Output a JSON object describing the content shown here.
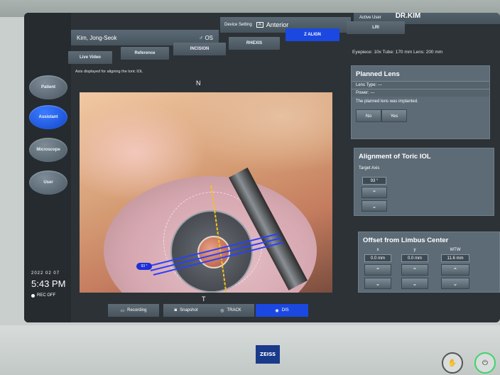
{
  "sidebar": {
    "items": [
      {
        "label": "Patient",
        "active": false
      },
      {
        "label": "Assistant",
        "active": true
      },
      {
        "label": "Microscope",
        "active": false
      },
      {
        "label": "User",
        "active": false
      }
    ],
    "date": "2022  02  07",
    "time": "5:43 PM",
    "rec": "REC OFF"
  },
  "header": {
    "patient_name": "Kim, Jong-Seok",
    "eye": "♂  OS",
    "device_setting_label": "Device Setting",
    "device_setting_badge": "A",
    "device_setting_value": "Anterior",
    "active_user_label": "Active User",
    "active_user": "DR.KIM"
  },
  "tabs_top": [
    {
      "label": "Z ALIGN",
      "active": true
    },
    {
      "label": "LRI",
      "active": false
    }
  ],
  "tabs_second": [
    {
      "label": "Live Video"
    },
    {
      "label": "Reference"
    },
    {
      "label": "INCISION"
    },
    {
      "label": "RHEXIS"
    }
  ],
  "eyepiece_info": "Eyepiece:  10x    Tube:  170 mm    Lens:  200 mm",
  "video": {
    "hint": "Axis displayed for aligning the toric IOL",
    "north": "N",
    "south": "T",
    "axis_tag": "93 °"
  },
  "bottom_tabs": [
    {
      "label": "Recording",
      "icon": "record-icon"
    },
    {
      "label": "Snapshot",
      "icon": "camera-icon"
    },
    {
      "label": "TRACK",
      "icon": "track-icon"
    },
    {
      "label": "DIS",
      "icon": "dis-icon",
      "active": true
    }
  ],
  "planned_lens": {
    "title": "Planned Lens",
    "lens_type": "Lens Type:  ---",
    "power": "Power:  ---",
    "implanted_text": "The planned lens was implanted.",
    "no_label": "No",
    "yes_label": "Yes"
  },
  "toric": {
    "title": "Alignment of Toric IOL",
    "target_axis_label": "Target Axis",
    "target_axis_value": "93 °"
  },
  "offset": {
    "title": "Offset from Limbus Center",
    "x_label": "x",
    "x_value": "0.0 mm",
    "y_label": "y",
    "y_value": "0.0 mm",
    "wtw_label": "WTW",
    "wtw_value": "11.6 mm"
  },
  "brand": "ZEISS",
  "colors": {
    "accent": "#1b48e0",
    "panel": "#5c6b76",
    "screen_bg": "#2c3236"
  }
}
